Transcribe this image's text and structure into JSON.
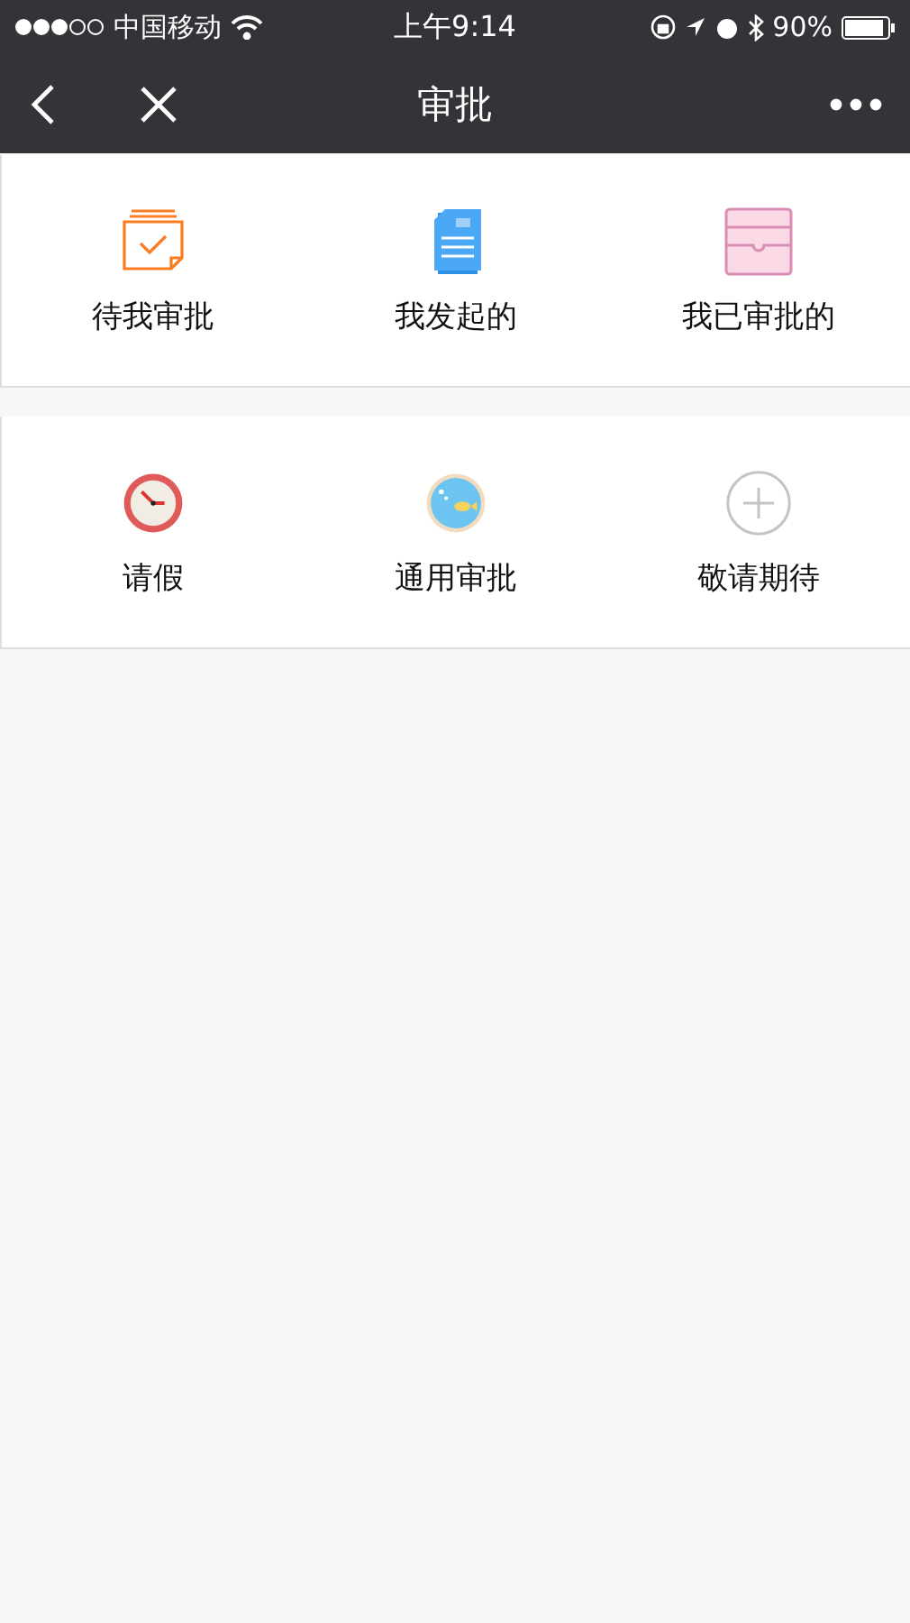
{
  "status_bar": {
    "carrier": "中国移动",
    "time": "上午9:14",
    "battery": "90%"
  },
  "nav_bar": {
    "title": "审批"
  },
  "sections": [
    {
      "items": [
        {
          "label": "待我审批",
          "kind": "pending"
        },
        {
          "label": "我发起的",
          "kind": "document"
        },
        {
          "label": "我已审批的",
          "kind": "archive"
        }
      ]
    },
    {
      "items": [
        {
          "label": "请假",
          "kind": "clock"
        },
        {
          "label": "通用审批",
          "kind": "fishbowl"
        },
        {
          "label": "敬请期待",
          "kind": "add"
        }
      ]
    }
  ]
}
